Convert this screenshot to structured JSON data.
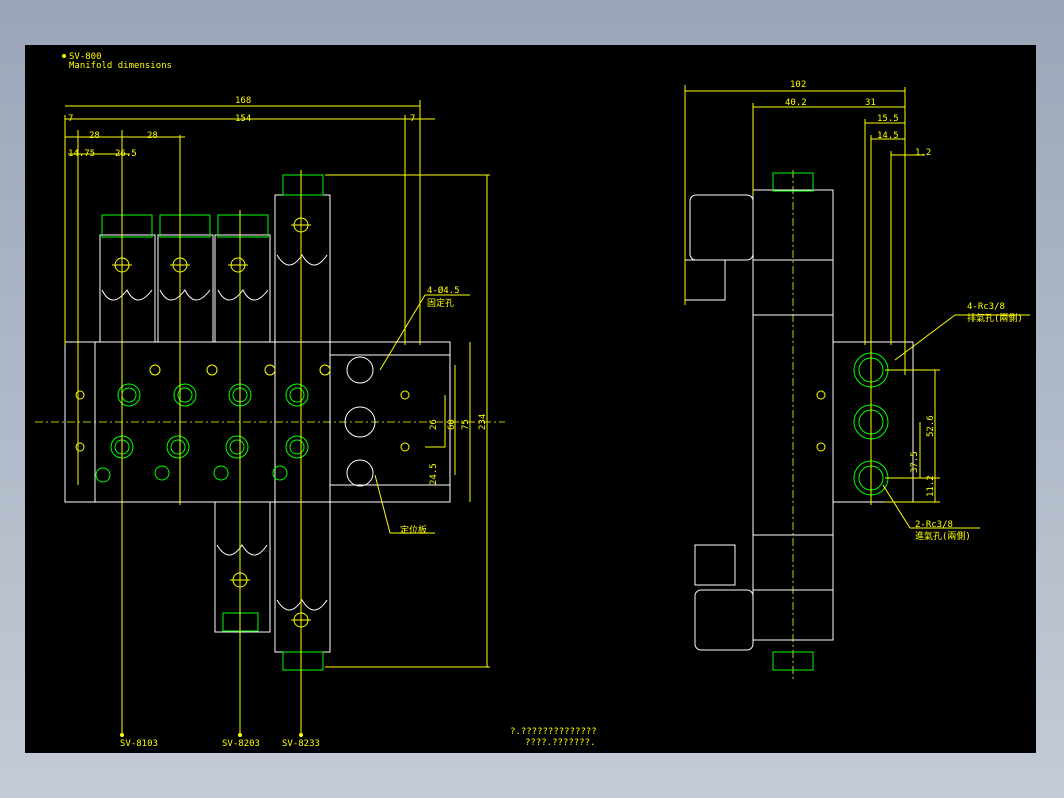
{
  "header": {
    "model": "SV-800",
    "subtitle": "Manifold dimensions"
  },
  "front_view": {
    "dims_top": [
      "168",
      "7",
      "154",
      "7",
      "28",
      "28",
      "14.75",
      "26.5"
    ],
    "dims_right": [
      "26",
      "60",
      "75",
      "234",
      "24.5"
    ],
    "callout_holes": {
      "line1": "4-Ø4.5",
      "line2": "固定孔"
    },
    "callout_plate": "定位板",
    "bottom_labels": [
      "SV-8103",
      "SV-8203",
      "SV-8233"
    ]
  },
  "side_view": {
    "dims_top": [
      "102",
      "40.2",
      "31",
      "15.5",
      "14.5",
      "1.2"
    ],
    "dims_right": [
      "52.6",
      "37.5",
      "11.2"
    ],
    "callout_exhaust": {
      "line1": "4-Rc3/8",
      "line2": "排氣孔(兩側)"
    },
    "callout_supply": {
      "line1": "2-Rc3/8",
      "line2": "進氣孔(兩側)"
    }
  },
  "note": {
    "line1": "?.??????????????",
    "line2": "????.???????."
  },
  "colors": {
    "background": "#000000",
    "lines": "#ffff00",
    "body": "#ffffff",
    "fittings": "#00ff00"
  }
}
